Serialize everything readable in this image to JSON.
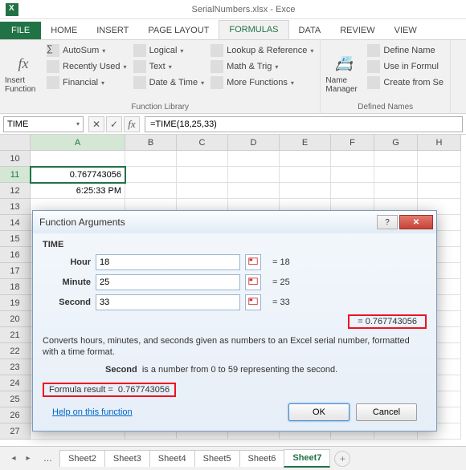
{
  "titlebar": {
    "title": "SerialNumbers.xlsx - Exce"
  },
  "tabs": {
    "file": "FILE",
    "home": "HOME",
    "insert": "INSERT",
    "page_layout": "PAGE LAYOUT",
    "formulas": "FORMULAS",
    "data": "DATA",
    "review": "REVIEW",
    "view": "VIEW"
  },
  "ribbon": {
    "insert_fn": "Insert Function",
    "autosum": "AutoSum",
    "recently": "Recently Used",
    "financial": "Financial",
    "logical": "Logical",
    "text": "Text",
    "datetime": "Date & Time",
    "lookup": "Lookup & Reference",
    "mathtrig": "Math & Trig",
    "more": "More Functions",
    "lib_label": "Function Library",
    "name_mgr": "Name Manager",
    "def_name": "Define Name",
    "use_formula": "Use in Formul",
    "create_sel": "Create from Se",
    "names_label": "Defined Names"
  },
  "formula_bar": {
    "name": "TIME",
    "formula": "=TIME(18,25,33)"
  },
  "grid": {
    "cols": [
      "A",
      "B",
      "C",
      "D",
      "E",
      "F",
      "G",
      "H"
    ],
    "rows": [
      "10",
      "11",
      "12",
      "13",
      "14",
      "15",
      "16",
      "17",
      "18",
      "19",
      "20",
      "21",
      "22",
      "23",
      "24",
      "25",
      "26",
      "27"
    ],
    "a11": "0.767743056",
    "a12": "6:25:33 PM"
  },
  "dialog": {
    "title": "Function Arguments",
    "fn": "TIME",
    "args": {
      "hour": {
        "label": "Hour",
        "value": "18",
        "eval": "= 18"
      },
      "minute": {
        "label": "Minute",
        "value": "25",
        "eval": "= 25"
      },
      "second": {
        "label": "Second",
        "value": "33",
        "eval": "= 33"
      }
    },
    "result": "= 0.767743056",
    "desc": "Converts hours, minutes, and seconds given as numbers to an Excel serial number, formatted with a time format.",
    "arg_desc_label": "Second",
    "arg_desc": "is a number from 0 to 59 representing the second.",
    "formula_result_label": "Formula result =",
    "formula_result": "0.767743056",
    "help": "Help on this function",
    "ok": "OK",
    "cancel": "Cancel"
  },
  "sheets": {
    "s2": "Sheet2",
    "s3": "Sheet3",
    "s4": "Sheet4",
    "s5": "Sheet5",
    "s6": "Sheet6",
    "s7": "Sheet7"
  }
}
